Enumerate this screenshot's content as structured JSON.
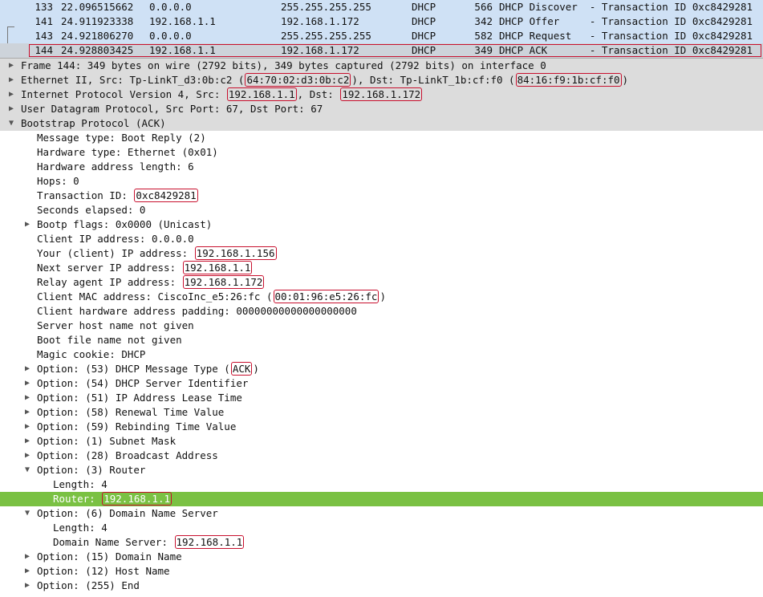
{
  "packets": [
    {
      "no": "133",
      "time": "22.096515662",
      "src": "0.0.0.0",
      "dst": "255.255.255.255",
      "proto": "DHCP",
      "len": "566",
      "info": "DHCP Discover  - Transaction ID 0xc8429281"
    },
    {
      "no": "141",
      "time": "24.911923338",
      "src": "192.168.1.1",
      "dst": "192.168.1.172",
      "proto": "DHCP",
      "len": "342",
      "info": "DHCP Offer     - Transaction ID 0xc8429281"
    },
    {
      "no": "143",
      "time": "24.921806270",
      "src": "0.0.0.0",
      "dst": "255.255.255.255",
      "proto": "DHCP",
      "len": "582",
      "info": "DHCP Request   - Transaction ID 0xc8429281"
    },
    {
      "no": "144",
      "time": "24.928803425",
      "src": "192.168.1.1",
      "dst": "192.168.1.172",
      "proto": "DHCP",
      "len": "349",
      "info": "DHCP ACK       - Transaction ID 0xc8429281",
      "selected": true
    }
  ],
  "tree": [
    {
      "indent": 0,
      "arrow": "right",
      "grey": true,
      "pre": "Frame 144: 349 bytes on wire (2792 bits), 349 bytes captured (2792 bits) on interface 0"
    },
    {
      "indent": 0,
      "arrow": "right",
      "grey": true,
      "pre": "Ethernet II, Src: Tp-LinkT_d3:0b:c2 (",
      "box": "64:70:02:d3:0b:c2",
      "mid": "), Dst: Tp-LinkT_1b:cf:f0 (",
      "box2": "84:16:f9:1b:cf:f0",
      "post": ")"
    },
    {
      "indent": 0,
      "arrow": "right",
      "grey": true,
      "pre": "Internet Protocol Version 4, Src: ",
      "box": "192.168.1.1",
      "mid": ", Dst: ",
      "box2": "192.168.1.172"
    },
    {
      "indent": 0,
      "arrow": "right",
      "grey": true,
      "pre": "User Datagram Protocol, Src Port: 67, Dst Port: 67"
    },
    {
      "indent": 0,
      "arrow": "down",
      "grey": true,
      "pre": "Bootstrap Protocol (ACK)"
    },
    {
      "indent": 1,
      "pre": "Message type: Boot Reply (2)"
    },
    {
      "indent": 1,
      "pre": "Hardware type: Ethernet (0x01)"
    },
    {
      "indent": 1,
      "pre": "Hardware address length: 6"
    },
    {
      "indent": 1,
      "pre": "Hops: 0"
    },
    {
      "indent": 1,
      "pre": "Transaction ID: ",
      "box": "0xc8429281"
    },
    {
      "indent": 1,
      "pre": "Seconds elapsed: 0"
    },
    {
      "indent": 1,
      "arrow": "right",
      "pre": "Bootp flags: 0x0000 (Unicast)"
    },
    {
      "indent": 1,
      "pre": "Client IP address: 0.0.0.0"
    },
    {
      "indent": 1,
      "pre": "Your (client) IP address: ",
      "box": "192.168.1.156"
    },
    {
      "indent": 1,
      "pre": "Next server IP address: ",
      "box": "192.168.1.1"
    },
    {
      "indent": 1,
      "pre": "Relay agent IP address: ",
      "box": "192.168.1.172"
    },
    {
      "indent": 1,
      "pre": "Client MAC address: CiscoInc_e5:26:fc (",
      "box": "00:01:96:e5:26:fc",
      "post": ")"
    },
    {
      "indent": 1,
      "pre": "Client hardware address padding: 00000000000000000000"
    },
    {
      "indent": 1,
      "pre": "Server host name not given"
    },
    {
      "indent": 1,
      "pre": "Boot file name not given"
    },
    {
      "indent": 1,
      "pre": "Magic cookie: DHCP"
    },
    {
      "indent": 1,
      "arrow": "right",
      "pre": "Option: (53) DHCP Message Type (",
      "box": "ACK",
      "post": ")"
    },
    {
      "indent": 1,
      "arrow": "right",
      "pre": "Option: (54) DHCP Server Identifier"
    },
    {
      "indent": 1,
      "arrow": "right",
      "pre": "Option: (51) IP Address Lease Time"
    },
    {
      "indent": 1,
      "arrow": "right",
      "pre": "Option: (58) Renewal Time Value"
    },
    {
      "indent": 1,
      "arrow": "right",
      "pre": "Option: (59) Rebinding Time Value"
    },
    {
      "indent": 1,
      "arrow": "right",
      "pre": "Option: (1) Subnet Mask"
    },
    {
      "indent": 1,
      "arrow": "right",
      "pre": "Option: (28) Broadcast Address"
    },
    {
      "indent": 1,
      "arrow": "down",
      "pre": "Option: (3) Router"
    },
    {
      "indent": 2,
      "pre": "Length: 4"
    },
    {
      "indent": 2,
      "highlight": true,
      "pre": "Router: ",
      "box": "192.168.1.1"
    },
    {
      "indent": 1,
      "arrow": "down",
      "pre": "Option: (6) Domain Name Server"
    },
    {
      "indent": 2,
      "pre": "Length: 4"
    },
    {
      "indent": 2,
      "pre": "Domain Name Server: ",
      "box": "192.168.1.1"
    },
    {
      "indent": 1,
      "arrow": "right",
      "pre": "Option: (15) Domain Name"
    },
    {
      "indent": 1,
      "arrow": "right",
      "pre": "Option: (12) Host Name"
    },
    {
      "indent": 1,
      "arrow": "right",
      "pre": "Option: (255) End"
    }
  ]
}
